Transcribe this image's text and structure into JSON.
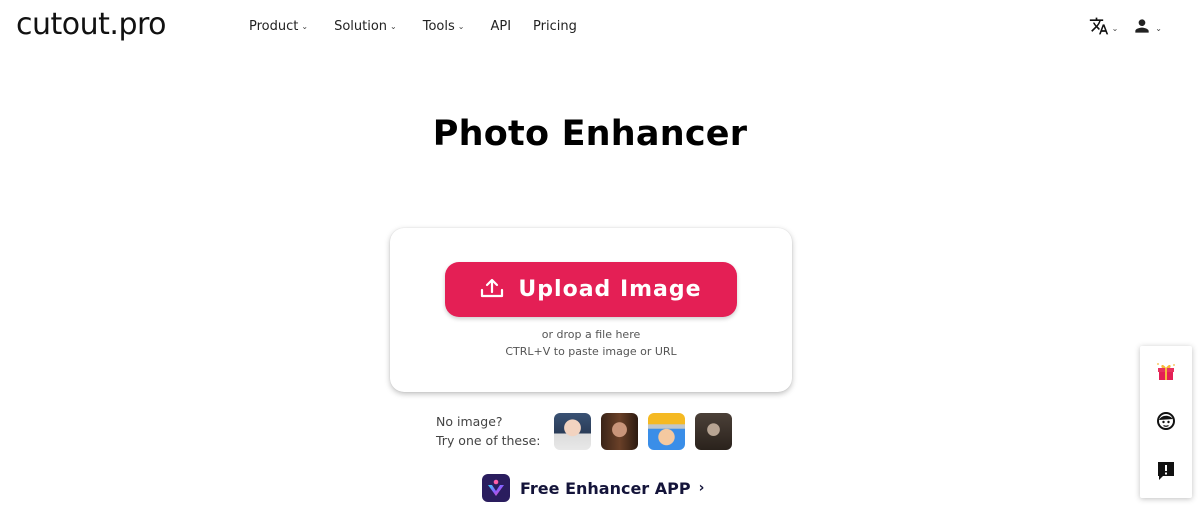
{
  "header": {
    "logo": "cutout.pro",
    "nav": [
      {
        "label": "Product",
        "dropdown": true
      },
      {
        "label": "Solution",
        "dropdown": true
      },
      {
        "label": "Tools",
        "dropdown": true
      },
      {
        "label": "API",
        "dropdown": false
      },
      {
        "label": "Pricing",
        "dropdown": false
      }
    ],
    "tools": {
      "language_icon": "translate-icon",
      "account_icon": "user-icon"
    }
  },
  "main": {
    "title": "Photo Enhancer",
    "upload": {
      "button_label": "Upload Image",
      "button_icon": "upload-icon",
      "hint_line1": "or drop a file here",
      "hint_line2": "CTRL+V to paste image or URL",
      "accent_color": "#e41f55"
    },
    "samples": {
      "line1": "No image?",
      "line2": "Try one of these:",
      "thumbnails": [
        "sample-girl",
        "sample-woman",
        "sample-anime",
        "sample-vintage-portrait"
      ]
    },
    "app_link": {
      "label": "Free Enhancer APP",
      "chevron": "›"
    }
  },
  "floating_bar": {
    "items": [
      "gift-icon",
      "support-icon",
      "feedback-icon"
    ]
  }
}
